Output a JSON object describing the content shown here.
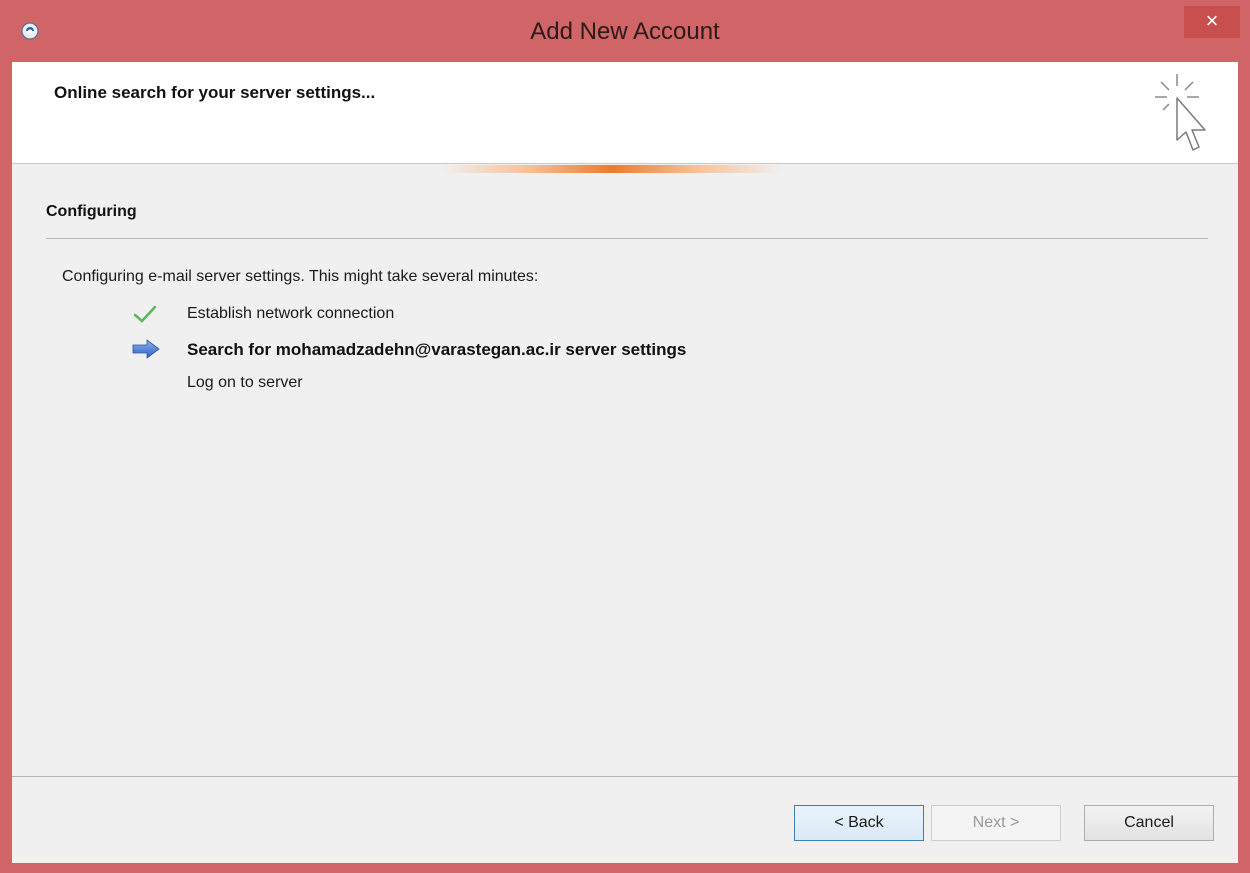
{
  "window": {
    "title": "Add New Account",
    "close_label": "×"
  },
  "header": {
    "title": "Online search for your server settings...",
    "icon": "cursor-click-icon"
  },
  "section": {
    "title": "Configuring",
    "intro": "Configuring e-mail server settings. This might take several minutes:"
  },
  "steps": [
    {
      "label": "Establish network connection",
      "status": "done",
      "icon": "checkmark-icon"
    },
    {
      "label": "Search for mohamadzadehn@varastegan.ac.ir server settings",
      "status": "in-progress",
      "icon": "arrow-right-icon"
    },
    {
      "label": "Log on to server",
      "status": "pending",
      "icon": ""
    }
  ],
  "buttons": {
    "back": "< Back",
    "next": "Next >",
    "cancel": "Cancel"
  },
  "colors": {
    "frame": "#d06466",
    "progress_accent": "#ec7b2c",
    "check": "#5cb85c",
    "arrow": "#3d6cc9"
  }
}
